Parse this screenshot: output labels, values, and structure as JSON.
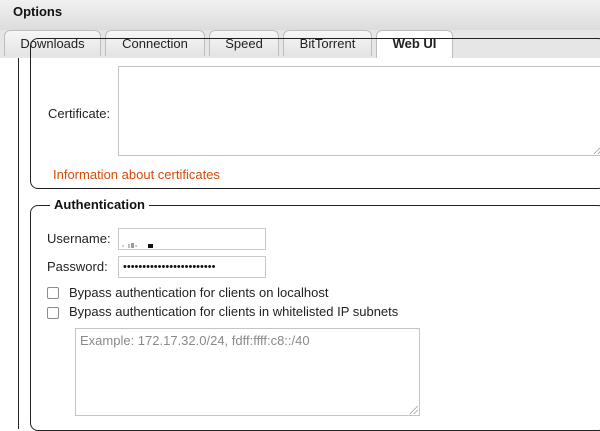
{
  "window": {
    "title": "Options"
  },
  "tabs": [
    {
      "label": "Downloads",
      "active": false
    },
    {
      "label": "Connection",
      "active": false
    },
    {
      "label": "Speed",
      "active": false
    },
    {
      "label": "BitTorrent",
      "active": false
    },
    {
      "label": "Web UI",
      "active": true
    }
  ],
  "https": {
    "certificate_label": "Certificate:",
    "certificate_value": "",
    "info_link": "Information about certificates",
    "link_color": "#d84a0b"
  },
  "auth": {
    "legend": "Authentication",
    "username_label": "Username:",
    "password_label": "Password:",
    "password_value": "••••••••••••••••••••••••",
    "bypass_localhost_label": "Bypass authentication for clients on localhost",
    "bypass_localhost_checked": false,
    "bypass_whitelist_label": "Bypass authentication for clients in whitelisted IP subnets",
    "bypass_whitelist_checked": false,
    "whitelist_placeholder": "Example: 172.17.32.0/24, fdff:ffff:c8::/40"
  }
}
